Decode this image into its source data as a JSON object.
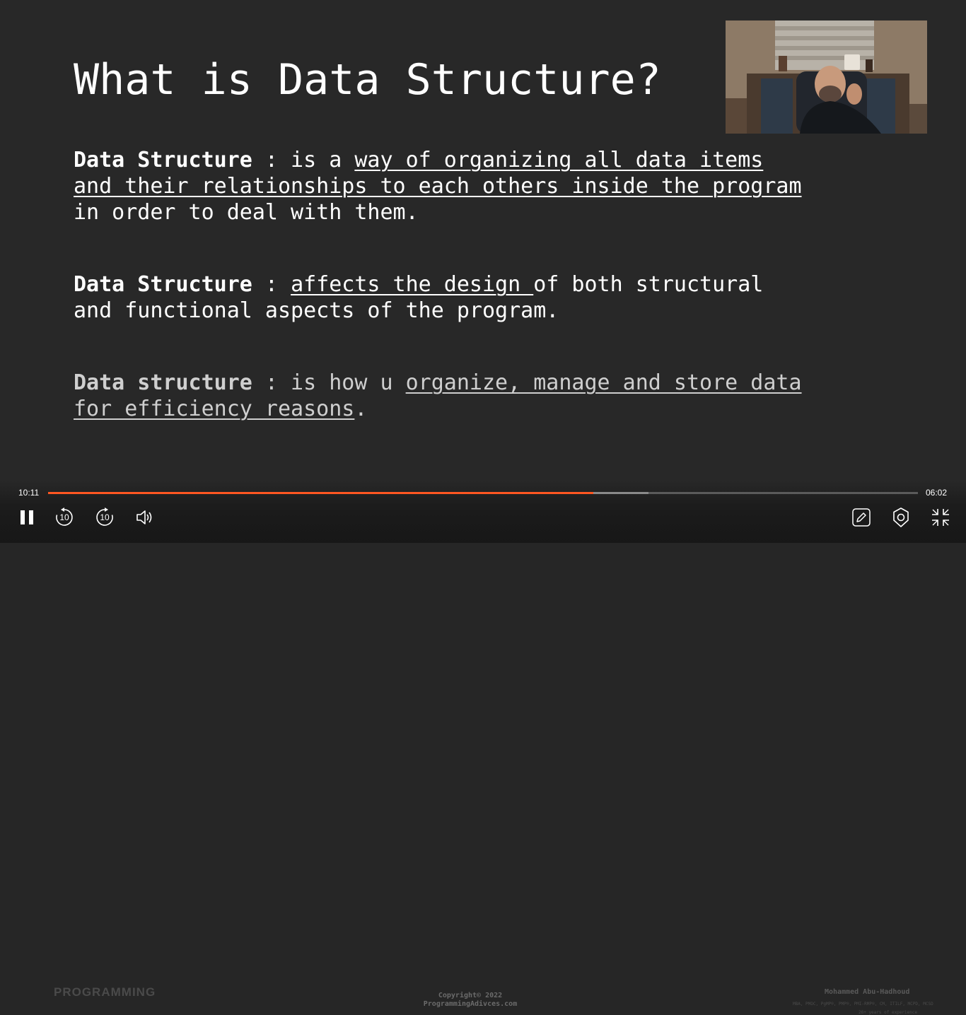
{
  "slide": {
    "title": "What is Data Structure?",
    "p1_term": "Data Structure",
    "p1_sep": " : is a ",
    "p1_ul_line1": "way of organizing all data items",
    "p1_ul_line2": "and their relationships to each others inside the program",
    "p1_line3": "in order to deal with them.",
    "p2_term": "Data Structure",
    "p2_sep": " : ",
    "p2_ul": "affects the design ",
    "p2_rest_line1": "of both structural",
    "p2_line2": "and functional aspects of the program.",
    "p3_term": "Data structure",
    "p3_sep": " : is how u ",
    "p3_ul_line1": "organize, manage and store data",
    "p3_ul_line2": "for efficiency reasons",
    "p3_end": "."
  },
  "player": {
    "current_time": "10:11",
    "remaining_time": "06:02",
    "progress_fraction": 0.627,
    "buffered_fraction": 0.69,
    "skip_back_label": "10",
    "skip_forward_label": "10",
    "accent_color": "#ff5722"
  },
  "watermark": {
    "copyright_line1": "Copyright© 2022",
    "copyright_line2": "ProgrammingAdivces.com",
    "brand": "PROGRAMMING",
    "author_name": "Mohammed Abu-Hadhoud",
    "author_credentials": "MBA, PMOC, PgMP®, PMP®, PMI-RMP®, CM, ITILF, MCPD, MCSD",
    "author_experience": "26+ years of experience"
  },
  "icons": {
    "pause": "pause-icon",
    "rewind": "rewind-10-icon",
    "forward": "forward-10-icon",
    "volume": "volume-icon",
    "annotate": "pencil-icon",
    "settings": "settings-icon",
    "exit_fullscreen": "exit-fullscreen-icon"
  }
}
